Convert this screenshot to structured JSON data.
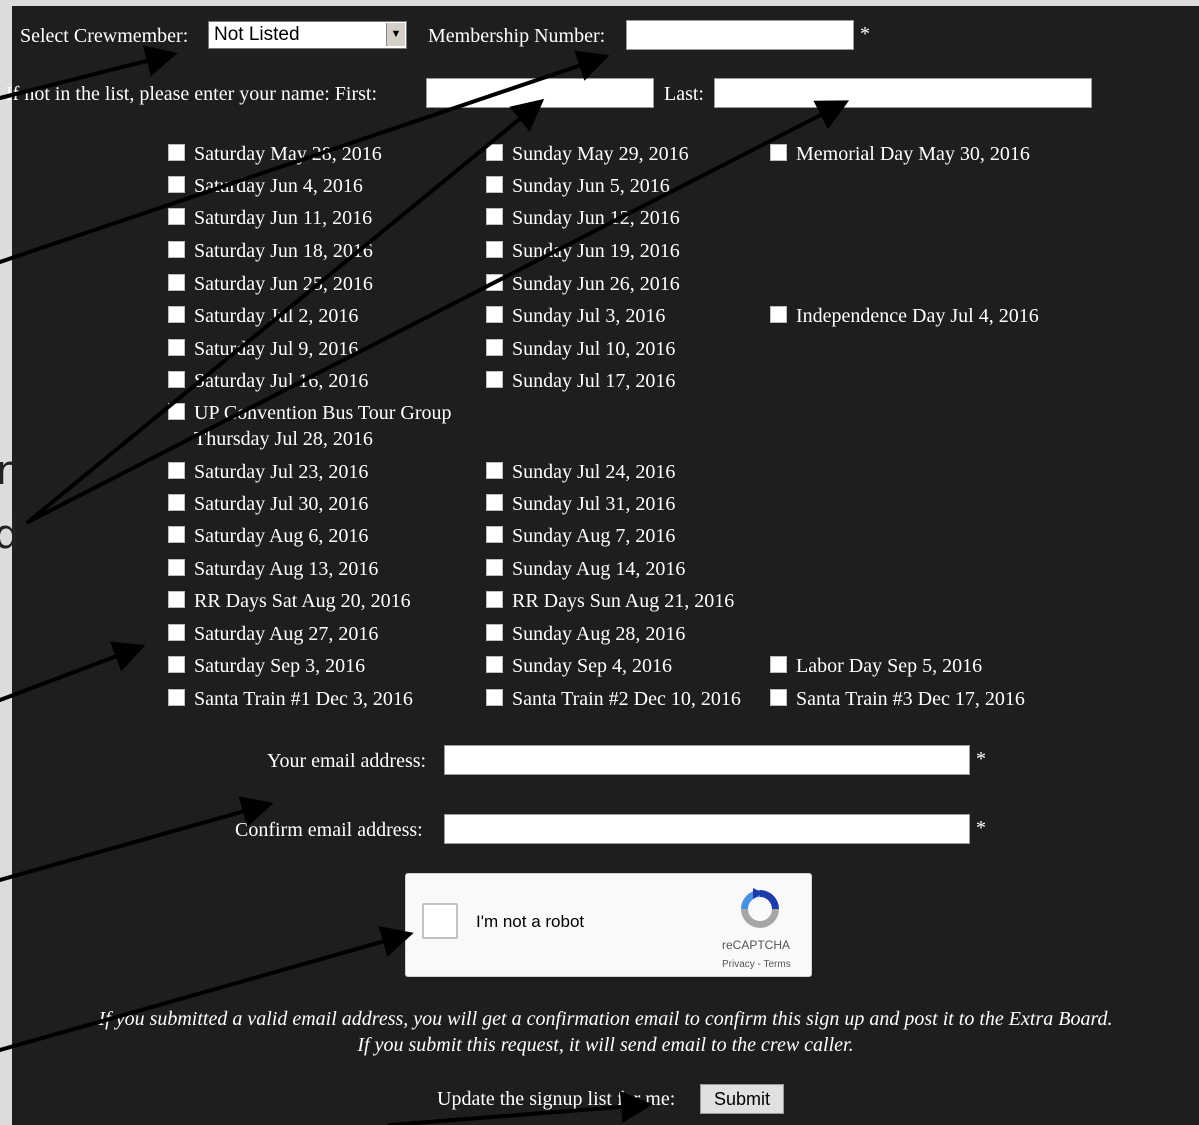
{
  "form": {
    "crewmember_label": "Select Crewmember:",
    "crewmember_value": "Not Listed",
    "membership_label": "Membership Number:",
    "membership_value": "",
    "required_marker": "*",
    "name_prompt": "If not in the list, please enter your name: First:",
    "last_label": "Last:",
    "first_value": "",
    "last_value": ""
  },
  "dates": {
    "col1": [
      "Saturday May 28, 2016",
      "Saturday Jun 4, 2016",
      "Saturday Jun 11, 2016",
      "Saturday Jun 18, 2016",
      "Saturday Jun 25, 2016",
      "Saturday Jul 2, 2016",
      "Saturday Jul 9, 2016",
      "Saturday Jul 16, 2016",
      "UP Convention Bus Tour Group",
      "Thursday Jul 28, 2016",
      "Saturday Jul 23, 2016",
      "Saturday Jul 30, 2016",
      "Saturday Aug 6, 2016",
      "Saturday Aug 13, 2016",
      "RR Days Sat Aug 20, 2016",
      "Saturday Aug 27, 2016",
      "Saturday Sep 3, 2016",
      "Santa Train #1 Dec 3, 2016"
    ],
    "col2": [
      "Sunday May 29, 2016",
      "Sunday Jun 5, 2016",
      "Sunday Jun 12, 2016",
      "Sunday Jun 19, 2016",
      "Sunday Jun 26, 2016",
      "Sunday Jul 3, 2016",
      "Sunday Jul 10, 2016",
      "Sunday Jul 17, 2016",
      "Sunday Jul 24, 2016",
      "Sunday Jul 31, 2016",
      "Sunday Aug 7, 2016",
      "Sunday Aug 14, 2016",
      "RR Days Sun Aug 21, 2016",
      "Sunday Aug 28, 2016",
      "Sunday Sep 4, 2016",
      "Santa Train #2 Dec 10, 2016"
    ],
    "col3": [
      "Memorial Day May 30, 2016",
      "Independence Day Jul 4, 2016",
      "Labor Day Sep 5, 2016",
      "Santa Train #3 Dec 17, 2016"
    ]
  },
  "email": {
    "email_label": "Your email address:",
    "confirm_label": "Confirm email address:",
    "email_value": "",
    "confirm_value": ""
  },
  "captcha": {
    "label": "I'm not a robot",
    "brand": "reCAPTCHA",
    "links": "Privacy - Terms"
  },
  "notes": {
    "line1": "If you submitted a valid email address, you will get a confirmation email to confirm this sign up and post it to the Extra Board.",
    "line2": "If you submit this request, it will send email to the crew caller."
  },
  "submit": {
    "prompt": "Update the signup list for me:",
    "button": "Submit"
  },
  "annotation": {
    "frag_upper": "r",
    "frag_lower": "d"
  }
}
